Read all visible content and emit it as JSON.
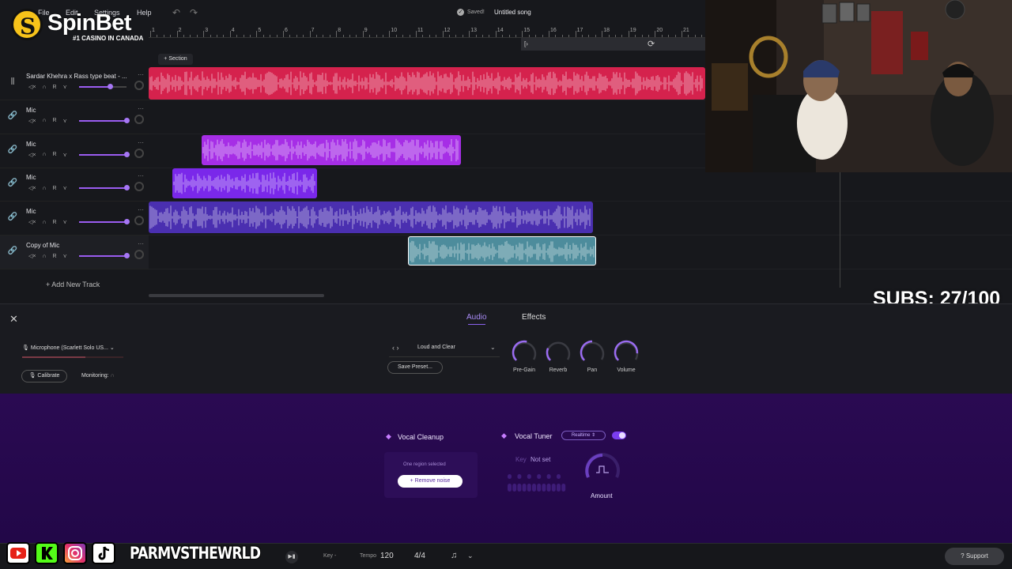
{
  "menu": {
    "file": "File",
    "edit": "Edit",
    "settings": "Settings",
    "help": "Help",
    "undo": "↶",
    "redo": "↷"
  },
  "status": {
    "saved": "Saved!",
    "song_title": "Untitled song"
  },
  "logo": {
    "brand": "SpinBet",
    "tagline": "#1 CASINO IN CANADA"
  },
  "ruler": {
    "numbers": [
      "1",
      "2",
      "3",
      "4",
      "5",
      "6",
      "7",
      "8",
      "9",
      "10",
      "11",
      "12",
      "13",
      "14",
      "15",
      "16",
      "17",
      "18",
      "19",
      "20",
      "21"
    ]
  },
  "section_label": "+ Section",
  "tracks": [
    {
      "name": "Sardar Khehra x Rass type beat - ...",
      "color": "#d5224d"
    },
    {
      "name": "Mic",
      "color": "#a62ee6"
    },
    {
      "name": "Mic",
      "color": "#a62ee6"
    },
    {
      "name": "Mic",
      "color": "#7a28ea"
    },
    {
      "name": "Mic",
      "color": "#4a2fb0"
    },
    {
      "name": "Copy of Mic",
      "color": "#4d8c9c"
    }
  ],
  "track_controls": {
    "r": "R",
    "dots": "···"
  },
  "add_track": "+ Add New Track",
  "subs": "SUBS: 27/100",
  "panel": {
    "tab_audio": "Audio",
    "tab_effects": "Effects",
    "mic": "Microphone (Scarlett Solo US...",
    "calibrate": "Calibrate",
    "monitoring": "Monitoring:",
    "preset_nav": "‹  ›",
    "preset": "Loud and Clear",
    "save_preset": "Save Preset...",
    "knobs": [
      "Pre-Gain",
      "Reverb",
      "Pan",
      "Volume"
    ]
  },
  "vocal_cleanup": {
    "title": "Vocal Cleanup",
    "selection": "One region selected",
    "button": "+ Remove noise"
  },
  "vocal_tuner": {
    "title": "Vocal Tuner",
    "mode": "Realtime ⇕",
    "key_label": "Key",
    "key_value": "Not set",
    "amount": "Amount"
  },
  "transport": {
    "key": "Key -",
    "tempo_label": "Tempo",
    "tempo": "120",
    "time_sig": "4/4",
    "support": "Support"
  },
  "social": {
    "handle": "PARMVSTHEWRLD"
  }
}
